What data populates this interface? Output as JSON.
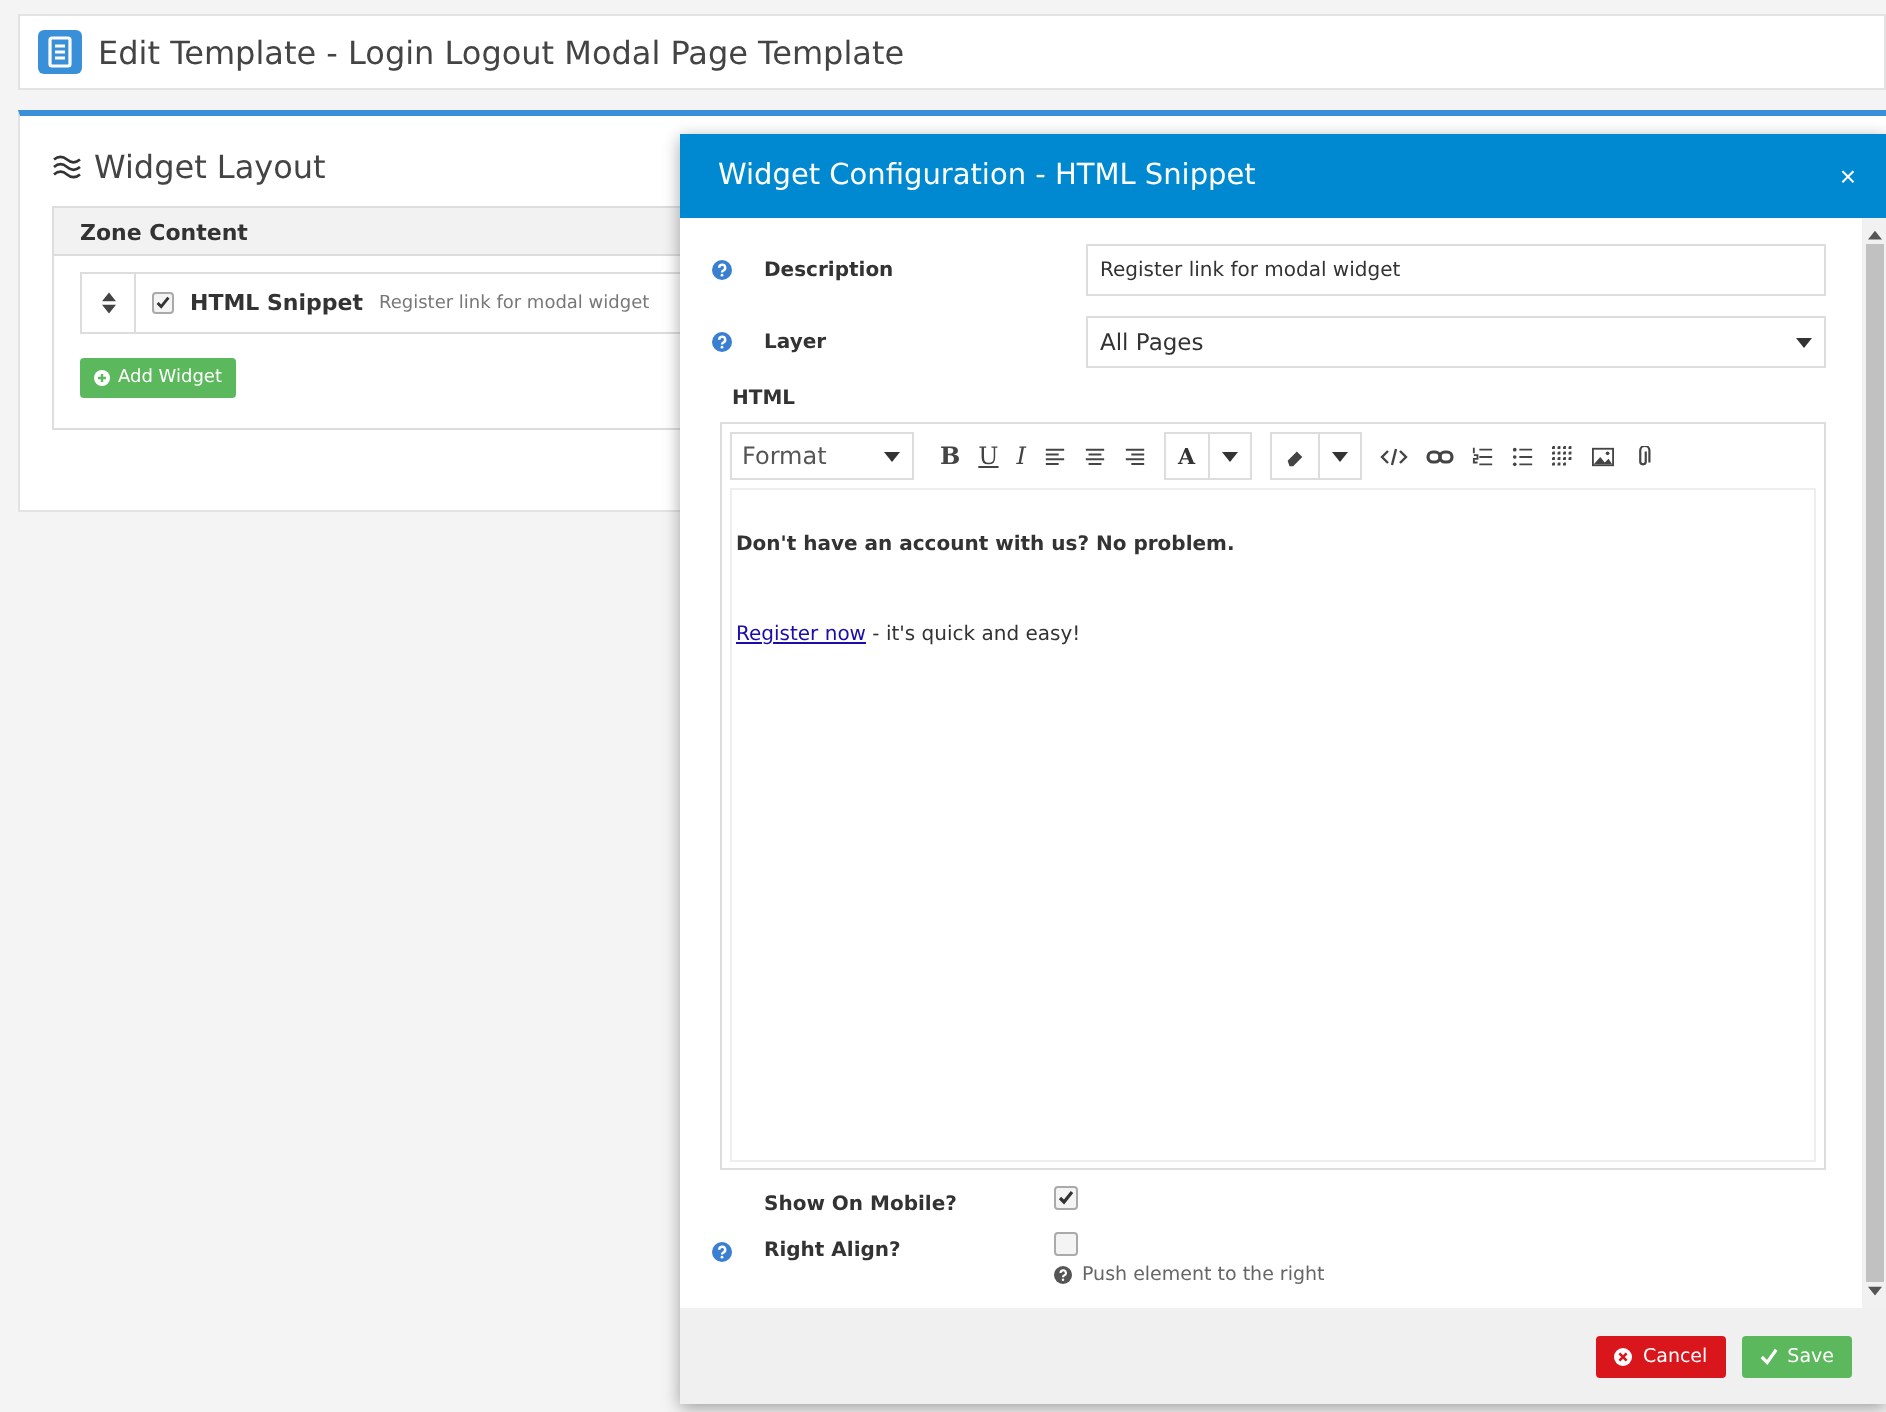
{
  "page_header": {
    "title": "Edit Template - Login Logout Modal Page Template"
  },
  "widget_layout": {
    "title": "Widget Layout",
    "zone": {
      "title": "Zone Content",
      "widgets": [
        {
          "name": "HTML Snippet",
          "description": "Register link for modal widget",
          "checked": true
        }
      ],
      "add_button": "Add Widget"
    }
  },
  "modal": {
    "title": "Widget Configuration - HTML Snippet",
    "close": "×",
    "description": {
      "label": "Description",
      "value": "Register link for modal widget"
    },
    "layer": {
      "label": "Layer",
      "value": "All Pages"
    },
    "html": {
      "label": "HTML",
      "toolbar": {
        "format": "Format",
        "bold": "B",
        "underline": "U",
        "italic": "I",
        "font_color": "A"
      },
      "content": {
        "heading": "Don't have an account with us? No problem.",
        "link": "Register now",
        "rest": " - it's quick and easy!"
      }
    },
    "show_on_mobile": {
      "label": "Show On Mobile?",
      "checked": true
    },
    "right_align": {
      "label": "Right Align?",
      "checked": false,
      "hint": "Push element to the right"
    },
    "buttons": {
      "cancel": "Cancel",
      "save": "Save"
    }
  }
}
